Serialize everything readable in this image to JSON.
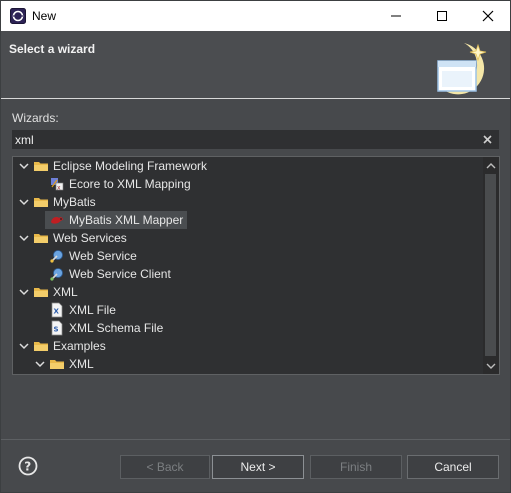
{
  "window": {
    "title": "New",
    "minimize_icon": "minimize-icon",
    "maximize_icon": "maximize-icon",
    "close_icon": "close-icon"
  },
  "header": {
    "title": "Select a wizard",
    "banner_icon": "wizard-banner-icon"
  },
  "wizards": {
    "label": "Wizards:",
    "filter_value": "xml",
    "clear_icon": "clear-icon"
  },
  "tree": {
    "items": [
      {
        "label": "Eclipse Modeling Framework",
        "icon": "folder-icon",
        "expanded": true
      },
      {
        "label": "Ecore to XML Mapping",
        "icon": "ecore-mapping-icon"
      },
      {
        "label": "MyBatis",
        "icon": "folder-icon",
        "expanded": true
      },
      {
        "label": "MyBatis XML Mapper",
        "icon": "mybatis-icon",
        "selected": true
      },
      {
        "label": "Web Services",
        "icon": "folder-icon",
        "expanded": true
      },
      {
        "label": "Web Service",
        "icon": "web-service-icon"
      },
      {
        "label": "Web Service Client",
        "icon": "web-service-client-icon"
      },
      {
        "label": "XML",
        "icon": "folder-icon",
        "expanded": true
      },
      {
        "label": "XML File",
        "icon": "xml-file-icon"
      },
      {
        "label": "XML Schema File",
        "icon": "xml-schema-icon"
      },
      {
        "label": "Examples",
        "icon": "folder-icon",
        "expanded": true
      },
      {
        "label": "XML",
        "icon": "folder-icon",
        "expanded": true
      }
    ]
  },
  "footer": {
    "help_icon": "help-icon",
    "back_label": "< Back",
    "next_label": "Next >",
    "finish_label": "Finish",
    "cancel_label": "Cancel"
  },
  "colors": {
    "background": "#47494c",
    "tree_background": "#2f3032",
    "selection": "#4a4d50",
    "folder": "#e8b84a"
  }
}
